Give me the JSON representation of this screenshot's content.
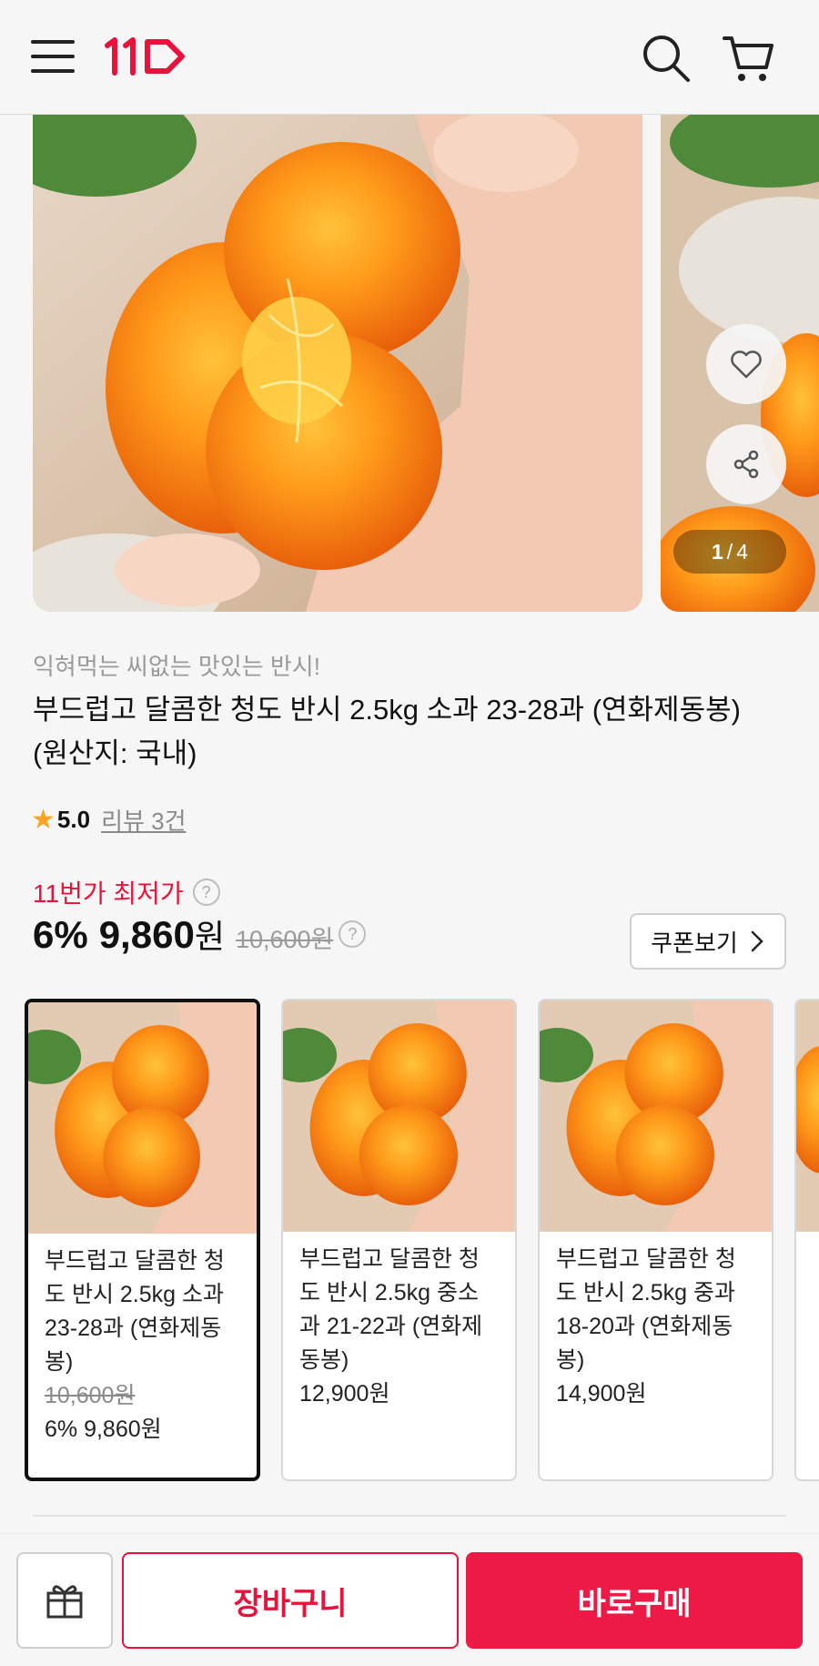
{
  "header": {
    "logo_icon": "11st-logo",
    "menu_icon": "hamburger-icon",
    "search_icon": "search-icon",
    "cart_icon": "cart-icon",
    "brand_color": "#e8123b"
  },
  "gallery": {
    "current": "1",
    "separator": "/",
    "total": "4"
  },
  "product": {
    "subtitle": "익혀먹는 씨없는 맛있는 반시!",
    "title": "부드럽고 달콤한 청도 반시 2.5kg 소과 23-28과 (연화제동봉) (원산지: 국내)",
    "rating": "5.0",
    "reviews": "리뷰 3건",
    "lowest_label": "11번가 최저가",
    "discount": "6%",
    "price": "9,860",
    "currency": "원",
    "original_price": "10,600원",
    "coupon_label": "쿠폰보기"
  },
  "options": [
    {
      "name": "부드럽고 달콤한 청도 반시 2.5kg 소과 23-28과 (연화제동봉)",
      "original_price": "10,600원",
      "price": "6% 9,860원"
    },
    {
      "name": "부드럽고 달콤한 청도 반시 2.5kg 중소과 21-22과 (연화제동봉)",
      "original_price": "",
      "price": "12,900원"
    },
    {
      "name": "부드럽고 달콤한 청도 반시 2.5kg 중과 18-20과 (연화제동봉)",
      "original_price": "",
      "price": "14,900원"
    }
  ],
  "bottom_bar": {
    "gift_icon": "gift-icon",
    "cart_label": "장바구니",
    "buy_label": "바로구매",
    "buy_color": "#ec1a45"
  }
}
